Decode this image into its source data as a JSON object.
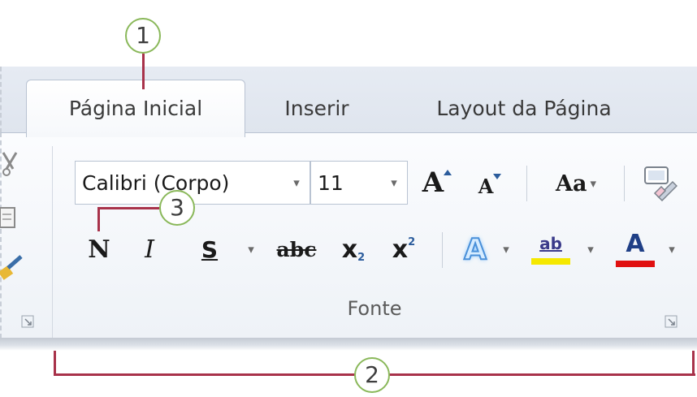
{
  "tabs": [
    {
      "label": "Página Inicial",
      "active": true
    },
    {
      "label": "Inserir",
      "active": false
    },
    {
      "label": "Layout da Página",
      "active": false
    }
  ],
  "font_group": {
    "label": "Fonte",
    "font_name": "Calibri (Corpo)",
    "font_size": "11",
    "grow_glyph": "A",
    "shrink_glyph": "A",
    "change_case_glyph": "Aa",
    "bold_glyph": "N",
    "italic_glyph": "I",
    "underline_glyph": "S",
    "strike_glyph": "abc",
    "subscript_glyph": "x",
    "subscript_index": "2",
    "superscript_glyph": "x",
    "superscript_index": "2",
    "effects_glyph": "A",
    "highlight_glyph": "ab",
    "font_color_glyph": "A"
  },
  "callouts": {
    "c1": "1",
    "c2": "2",
    "c3": "3"
  },
  "colors": {
    "highlight": "#f5e800",
    "font_color": "#e01010",
    "callout_line": "#a8324a",
    "callout_ring": "#8ab85a"
  },
  "icons": [
    "cut-icon",
    "copy-icon",
    "format-painter-icon",
    "clear-formatting-icon",
    "dialog-launcher-icon"
  ]
}
